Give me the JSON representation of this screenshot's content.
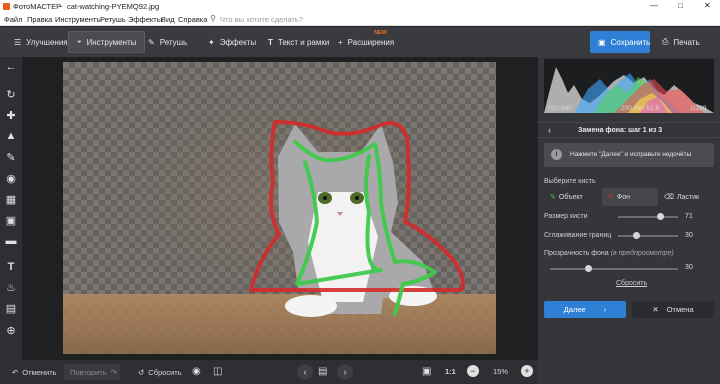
{
  "window": {
    "app_name": "ФотоМАСТЕР",
    "separator": "-",
    "file_name": "cat-watching-PYEMQ92.jpg",
    "controls": [
      "—",
      "□",
      "✕"
    ]
  },
  "menu": {
    "items": [
      "Файл",
      "Правка",
      "Инструменты",
      "Ретушь",
      "Эффекты",
      "Вид",
      "Справка"
    ],
    "search_placeholder": "Что вы хотите сделать?"
  },
  "toolbar": {
    "tabs": [
      {
        "label": "Улучшения",
        "icon": "sliders-icon"
      },
      {
        "label": "Инструменты",
        "icon": "crop-icon"
      },
      {
        "label": "Ретушь",
        "icon": "brush-icon"
      },
      {
        "label": "Эффекты",
        "icon": "wand-icon"
      },
      {
        "label": "Текст и рамки",
        "icon": "text-icon"
      },
      {
        "label": "Расширения",
        "icon": "plus-icon",
        "badge": "NEW"
      }
    ],
    "save_label": "Сохранить",
    "print_label": "Печать"
  },
  "left_tools": [
    "back-arrow-icon",
    "rotate-icon",
    "bandage-icon",
    "stamp-icon",
    "brush-icon",
    "radial-icon",
    "gradient-icon",
    "vignette-icon",
    "tilt-icon",
    "text-icon",
    "bucket-icon",
    "layers-icon",
    "globe-icon"
  ],
  "bottombar": {
    "undo_label": "Отменить",
    "redo_label": "Повторить",
    "reset_label": "Сбросить",
    "ratio_label": "1:1",
    "zoom_value": "15%"
  },
  "histogram_info": {
    "iso": "ISO 640",
    "lens": "200 mm f/2.8",
    "shutter": "1/160"
  },
  "panel": {
    "step_title": "Замена фона: шаг 1 из 3",
    "hint_text": "Нажмите \"Далее\" и исправьте недочёты",
    "brush_heading": "Выберите кисть",
    "brush_object": "Объект",
    "brush_background": "Фон",
    "brush_eraser": "Ластик",
    "brush_size_label": "Размер кисти",
    "brush_size_value": "71",
    "brush_size_fraction": 0.71,
    "smoothing_label": "Сглаживание границ",
    "smoothing_value": "30",
    "smoothing_fraction": 0.3,
    "opacity_label": "Прозрачность фона",
    "opacity_note": "(в предпросмотре)",
    "opacity_value": "30",
    "opacity_fraction": 0.3,
    "reset_link": "Сбросить",
    "next_label": "Далее",
    "cancel_label": "Отмена"
  },
  "colors": {
    "accent_blue": "#2f7fd6",
    "object_stroke": "#3fc94a",
    "background_stroke": "#d42a2a"
  }
}
